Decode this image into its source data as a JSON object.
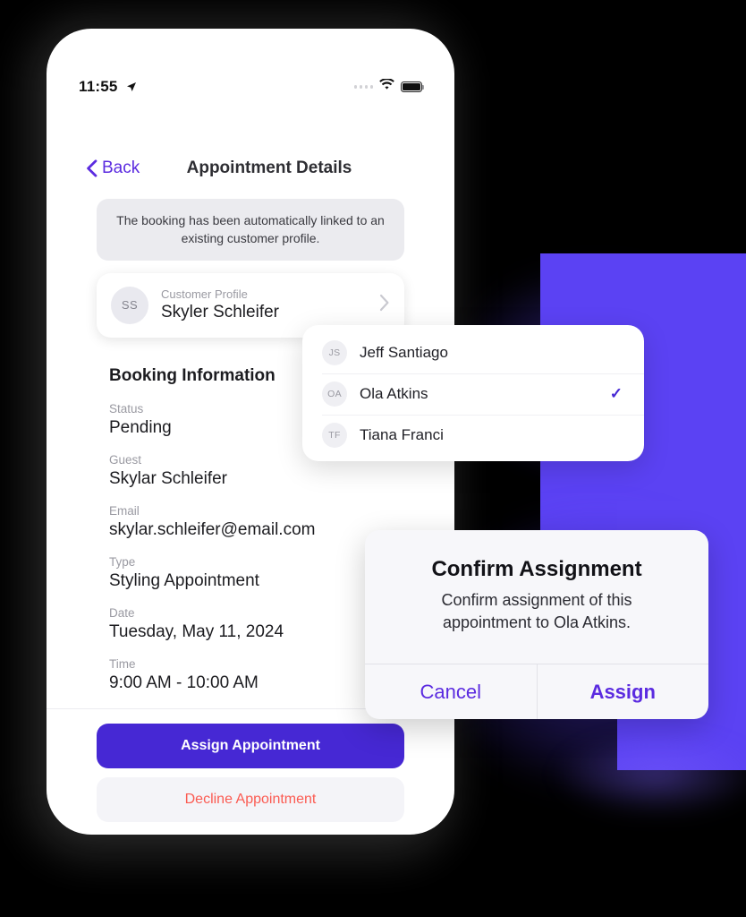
{
  "status_bar": {
    "time": "11:55",
    "location_icon": "location-arrow-icon",
    "wifi_icon": "wifi-icon",
    "battery_icon": "battery-icon"
  },
  "nav": {
    "back_label": "Back",
    "title": "Appointment Details"
  },
  "banner": {
    "text": "The booking has been automatically linked to an existing customer profile."
  },
  "profile_card": {
    "initials": "SS",
    "label": "Customer Profile",
    "name": "Skyler Schleifer"
  },
  "booking": {
    "heading": "Booking Information",
    "fields": [
      {
        "label": "Status",
        "value": "Pending"
      },
      {
        "label": "Guest",
        "value": "Skylar Schleifer"
      },
      {
        "label": "Email",
        "value": "skylar.schleifer@email.com"
      },
      {
        "label": "Type",
        "value": "Styling Appointment"
      },
      {
        "label": "Date",
        "value": "Tuesday, May 11, 2024"
      },
      {
        "label": "Time",
        "value": "9:00 AM - 10:00 AM"
      }
    ]
  },
  "actions": {
    "assign_label": "Assign Appointment",
    "decline_label": "Decline Appointment"
  },
  "staff_dropdown": {
    "items": [
      {
        "initials": "JS",
        "name": "Jeff Santiago",
        "selected": false,
        "check": ""
      },
      {
        "initials": "OA",
        "name": "Ola Atkins",
        "selected": true,
        "check": "✓"
      },
      {
        "initials": "TF",
        "name": "Tiana Franci",
        "selected": false,
        "check": ""
      }
    ]
  },
  "confirm_dialog": {
    "title": "Confirm Assignment",
    "message": "Confirm assignment of this appointment to Ola Atkins.",
    "cancel_label": "Cancel",
    "assign_label": "Assign"
  },
  "colors": {
    "brand_purple": "#4628D4",
    "link_purple": "#5B2BE0",
    "decor_purple": "#5B42F3",
    "danger_red": "#FB5B52",
    "background": "#000000"
  }
}
